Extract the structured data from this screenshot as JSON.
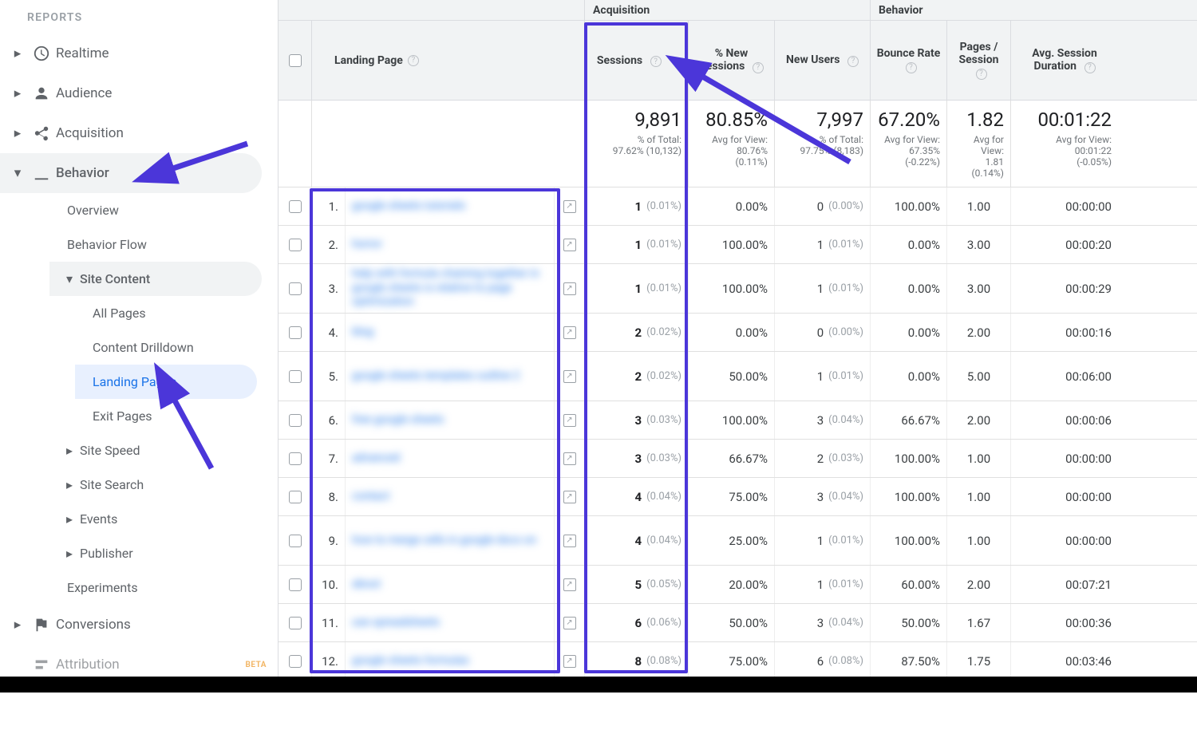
{
  "sidebar": {
    "section_label": "REPORTS",
    "items": [
      {
        "id": "realtime",
        "label": "Realtime"
      },
      {
        "id": "audience",
        "label": "Audience"
      },
      {
        "id": "acquisition",
        "label": "Acquisition"
      },
      {
        "id": "behavior",
        "label": "Behavior",
        "children": [
          {
            "id": "overview",
            "label": "Overview"
          },
          {
            "id": "behavior-flow",
            "label": "Behavior Flow"
          },
          {
            "id": "site-content",
            "label": "Site Content",
            "children": [
              {
                "id": "all-pages",
                "label": "All Pages"
              },
              {
                "id": "content-drilldown",
                "label": "Content Drilldown"
              },
              {
                "id": "landing-pages",
                "label": "Landing Pages"
              },
              {
                "id": "exit-pages",
                "label": "Exit Pages"
              }
            ]
          },
          {
            "id": "site-speed",
            "label": "Site Speed"
          },
          {
            "id": "site-search",
            "label": "Site Search"
          },
          {
            "id": "events",
            "label": "Events"
          },
          {
            "id": "publisher",
            "label": "Publisher"
          },
          {
            "id": "experiments",
            "label": "Experiments"
          }
        ]
      },
      {
        "id": "conversions",
        "label": "Conversions"
      },
      {
        "id": "attribution",
        "label": "Attribution",
        "beta": "BETA"
      }
    ]
  },
  "columns": {
    "landing_page": "Landing Page",
    "groups": {
      "acquisition": "Acquisition",
      "behavior": "Behavior"
    },
    "sessions": "Sessions",
    "pct_new_sessions": "% New Sessions",
    "new_users": "New Users",
    "bounce_rate": "Bounce Rate",
    "pages_per_session": "Pages / Session",
    "avg_session_duration": "Avg. Session Duration",
    "help": "?",
    "sort_arrow": "↑",
    "open_icon": "↗"
  },
  "summary": {
    "sessions": {
      "big": "9,891",
      "sub1": "% of Total:",
      "sub2": "97.62% (10,132)"
    },
    "pct_new": {
      "big": "80.85%",
      "sub1": "Avg for View:",
      "sub2": "80.76%",
      "sub3": "(0.11%)"
    },
    "new_users": {
      "big": "7,997",
      "sub1": "% of Total:",
      "sub2": "97.75% (8,183)"
    },
    "bounce": {
      "big": "67.20%",
      "sub1": "Avg for View:",
      "sub2": "67.35%",
      "sub3": "(-0.22%)"
    },
    "pps": {
      "big": "1.82",
      "sub1": "Avg for",
      "sub2": "View:",
      "sub3": "1.81",
      "sub4": "(0.14%)"
    },
    "avg": {
      "big": "00:01:22",
      "sub1": "Avg for View:",
      "sub2": "00:01:22",
      "sub3": "(-0.05%)"
    }
  },
  "rows": [
    {
      "idx": "1.",
      "page": "google sheets tutorials",
      "sessions": "1",
      "sessions_pct": "(0.01%)",
      "pct_new": "0.00%",
      "new_users": "0",
      "new_users_pct": "(0.00%)",
      "bounce": "100.00%",
      "pps": "1.00",
      "avg": "00:00:00"
    },
    {
      "idx": "2.",
      "page": "horror",
      "sessions": "1",
      "sessions_pct": "(0.01%)",
      "pct_new": "100.00%",
      "new_users": "1",
      "new_users_pct": "(0.01%)",
      "bounce": "0.00%",
      "pps": "3.00",
      "avg": "00:00:20"
    },
    {
      "idx": "3.",
      "page": "help with formula chaining together in google sheets is relative to page optimization",
      "sessions": "1",
      "sessions_pct": "(0.01%)",
      "pct_new": "100.00%",
      "new_users": "1",
      "new_users_pct": "(0.01%)",
      "bounce": "0.00%",
      "pps": "3.00",
      "avg": "00:00:29",
      "tall": true
    },
    {
      "idx": "4.",
      "page": "blog",
      "sessions": "2",
      "sessions_pct": "(0.02%)",
      "pct_new": "0.00%",
      "new_users": "0",
      "new_users_pct": "(0.00%)",
      "bounce": "0.00%",
      "pps": "2.00",
      "avg": "00:00:16"
    },
    {
      "idx": "5.",
      "page": "google sheets templates outline 2",
      "sessions": "2",
      "sessions_pct": "(0.02%)",
      "pct_new": "50.00%",
      "new_users": "1",
      "new_users_pct": "(0.01%)",
      "bounce": "0.00%",
      "pps": "5.00",
      "avg": "00:06:00",
      "tall": true
    },
    {
      "idx": "6.",
      "page": "free google sheets",
      "sessions": "3",
      "sessions_pct": "(0.03%)",
      "pct_new": "100.00%",
      "new_users": "3",
      "new_users_pct": "(0.04%)",
      "bounce": "66.67%",
      "pps": "2.00",
      "avg": "00:00:06"
    },
    {
      "idx": "7.",
      "page": "advanced",
      "sessions": "3",
      "sessions_pct": "(0.03%)",
      "pct_new": "66.67%",
      "new_users": "2",
      "new_users_pct": "(0.03%)",
      "bounce": "100.00%",
      "pps": "1.00",
      "avg": "00:00:00"
    },
    {
      "idx": "8.",
      "page": "contact",
      "sessions": "4",
      "sessions_pct": "(0.04%)",
      "pct_new": "75.00%",
      "new_users": "3",
      "new_users_pct": "(0.04%)",
      "bounce": "100.00%",
      "pps": "1.00",
      "avg": "00:00:00"
    },
    {
      "idx": "9.",
      "page": "how to merge cells in google docs on",
      "sessions": "4",
      "sessions_pct": "(0.04%)",
      "pct_new": "25.00%",
      "new_users": "1",
      "new_users_pct": "(0.01%)",
      "bounce": "100.00%",
      "pps": "1.00",
      "avg": "00:00:00",
      "tall": true
    },
    {
      "idx": "10.",
      "page": "about",
      "sessions": "5",
      "sessions_pct": "(0.05%)",
      "pct_new": "20.00%",
      "new_users": "1",
      "new_users_pct": "(0.01%)",
      "bounce": "60.00%",
      "pps": "2.00",
      "avg": "00:07:21"
    },
    {
      "idx": "11.",
      "page": "use spreadsheets",
      "sessions": "6",
      "sessions_pct": "(0.06%)",
      "pct_new": "50.00%",
      "new_users": "3",
      "new_users_pct": "(0.04%)",
      "bounce": "50.00%",
      "pps": "1.67",
      "avg": "00:00:36"
    },
    {
      "idx": "12.",
      "page": "google sheets formulas",
      "sessions": "8",
      "sessions_pct": "(0.08%)",
      "pct_new": "75.00%",
      "new_users": "6",
      "new_users_pct": "(0.08%)",
      "bounce": "87.50%",
      "pps": "1.75",
      "avg": "00:03:46"
    }
  ]
}
